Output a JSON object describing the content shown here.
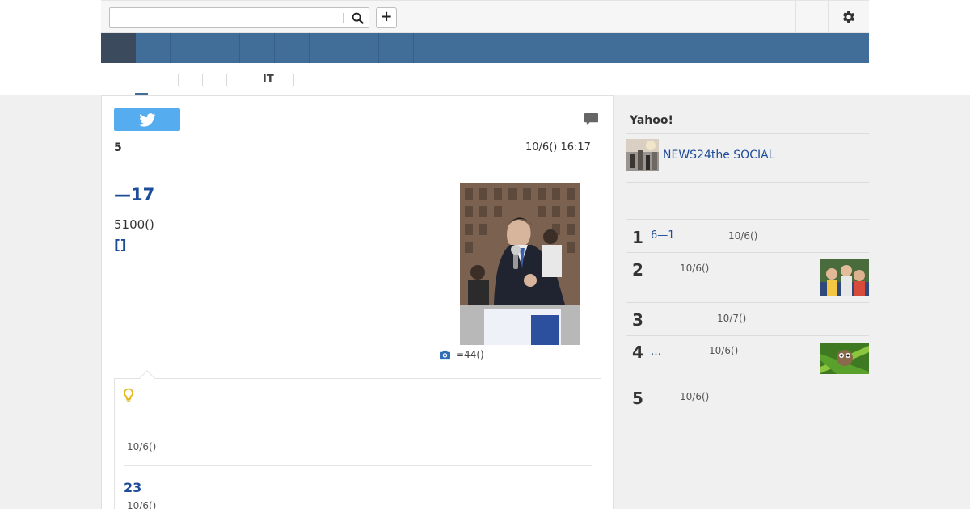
{
  "search": {
    "placeholder": "",
    "value": ""
  },
  "topbar": {
    "add_label": "+"
  },
  "subnav": {
    "items": [
      "",
      "",
      "",
      "",
      "",
      "IT",
      "",
      ""
    ]
  },
  "article": {
    "source": "5",
    "timestamp": "10/6() 16:17",
    "headline": "—17",
    "summary": "5100()",
    "more_link": "[]",
    "photo_caption": "=44()"
  },
  "related": {
    "item1_date": "10/6()",
    "item2_title": "23",
    "item2_date": "10/6()"
  },
  "sidebar": {
    "title": "Yahoo!",
    "yahoo_item_label": "NEWS24the SOCIAL",
    "ranking": [
      {
        "rank": "1",
        "text": "6—1",
        "date": "10/6()"
      },
      {
        "rank": "2",
        "text": "",
        "date": "10/6()"
      },
      {
        "rank": "3",
        "text": "",
        "date": "10/7()"
      },
      {
        "rank": "4",
        "text": "…",
        "date": "10/6()"
      },
      {
        "rank": "5",
        "text": "",
        "date": "10/6()"
      }
    ]
  },
  "colors": {
    "nav": "#416d99",
    "nav_home": "#3b4a5c",
    "link": "#1d4c9a",
    "twitter": "#55acee"
  },
  "icons": [
    "search-icon",
    "gear-icon",
    "twitter-icon",
    "comment-icon",
    "camera-icon",
    "lightbulb-icon"
  ]
}
